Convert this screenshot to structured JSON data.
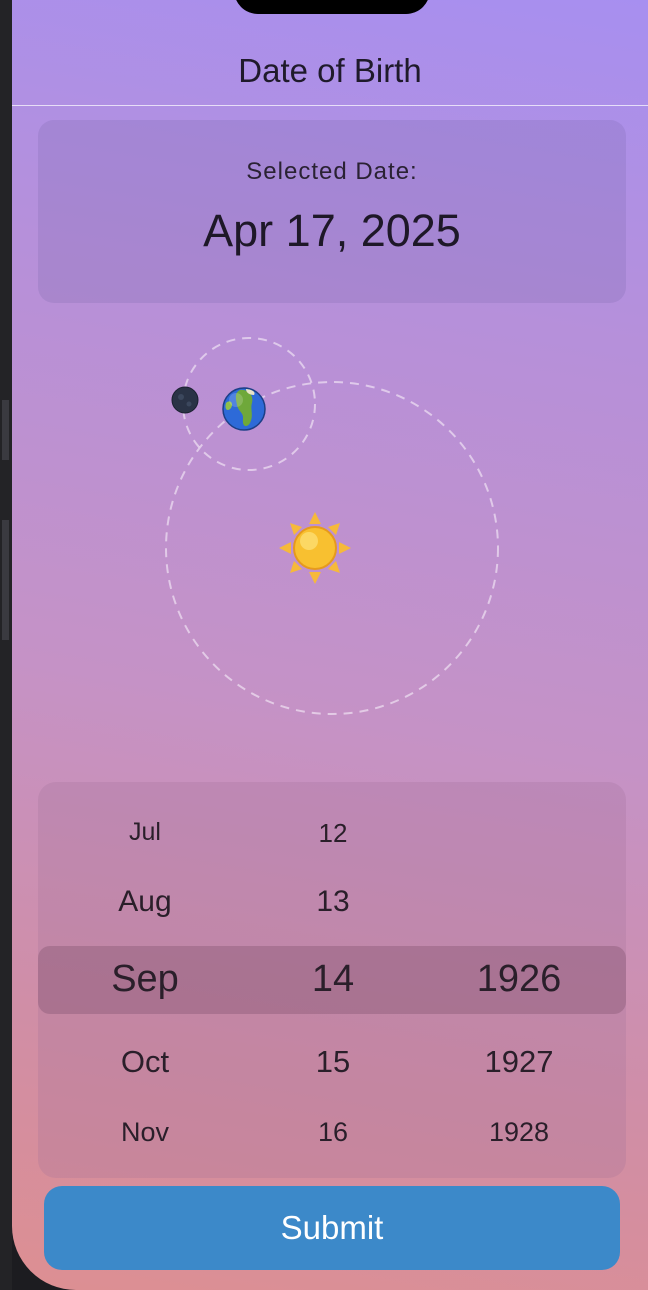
{
  "header": {
    "title": "Date of Birth"
  },
  "selected_date": {
    "label": "Selected Date:",
    "value": "Apr 17, 2025"
  },
  "orbit": {
    "earth_icon": "earth-globe-icon",
    "moon_icon": "moon-icon",
    "sun_icon": "sun-icon",
    "orbit_line_color": "#f2e8f6",
    "sun_color": "#f8c030",
    "earth_ocean_color": "#2d6ad8",
    "earth_land_color": "#6fa83a",
    "moon_color": "#2a3346"
  },
  "picker": {
    "months": [
      "Jul",
      "Aug",
      "Sep",
      "Oct",
      "Nov"
    ],
    "days": [
      "12",
      "13",
      "14",
      "15",
      "16"
    ],
    "years": [
      "",
      "",
      "1926",
      "1927",
      "1928"
    ],
    "selected_index": 2
  },
  "submit": {
    "label": "Submit",
    "color": "#3c89c9"
  }
}
